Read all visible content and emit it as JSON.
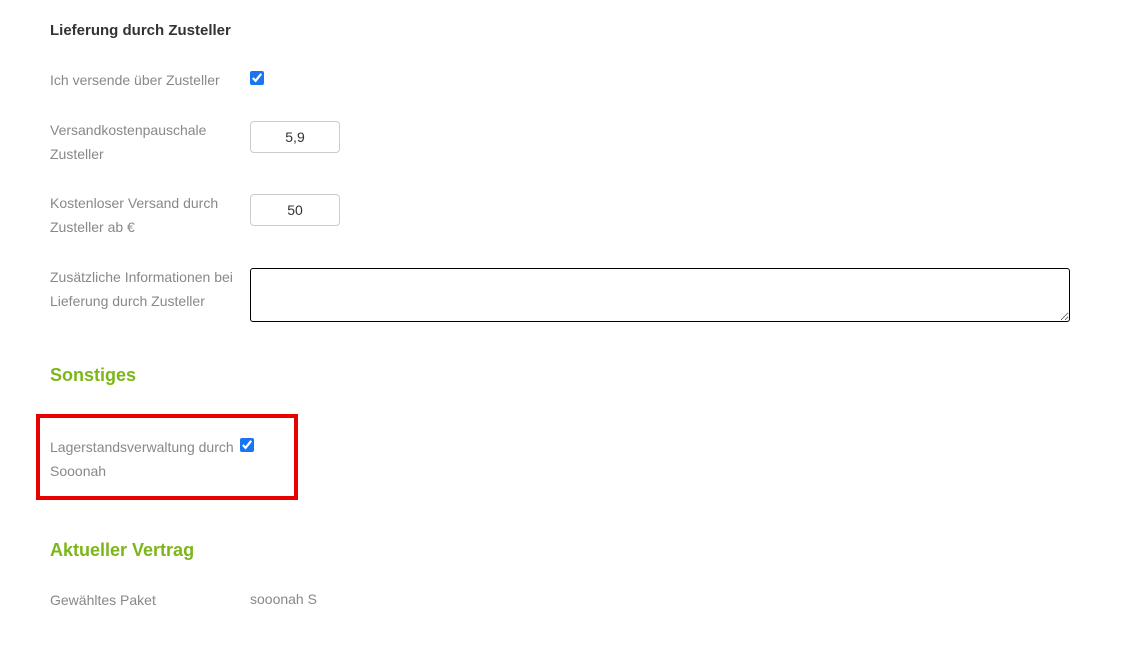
{
  "delivery": {
    "title": "Lieferung durch Zusteller",
    "ship_via_courier_label": "Ich versende über Zusteller",
    "ship_via_courier_checked": true,
    "flat_rate_label": "Versandkostenpauschale Zusteller",
    "flat_rate_value": "5,9",
    "free_shipping_label": "Kostenloser Versand durch Zusteller ab €",
    "free_shipping_value": "50",
    "additional_info_label": "Zusätzliche Informationen bei Lieferung durch Zusteller",
    "additional_info_value": ""
  },
  "misc": {
    "title": "Sonstiges",
    "stock_mgmt_label": "Lagerstandsverwaltung durch Sooonah",
    "stock_mgmt_checked": true
  },
  "contract": {
    "title": "Aktueller Vertrag",
    "package_label": "Gewähltes Paket",
    "package_value": "sooonah S"
  }
}
